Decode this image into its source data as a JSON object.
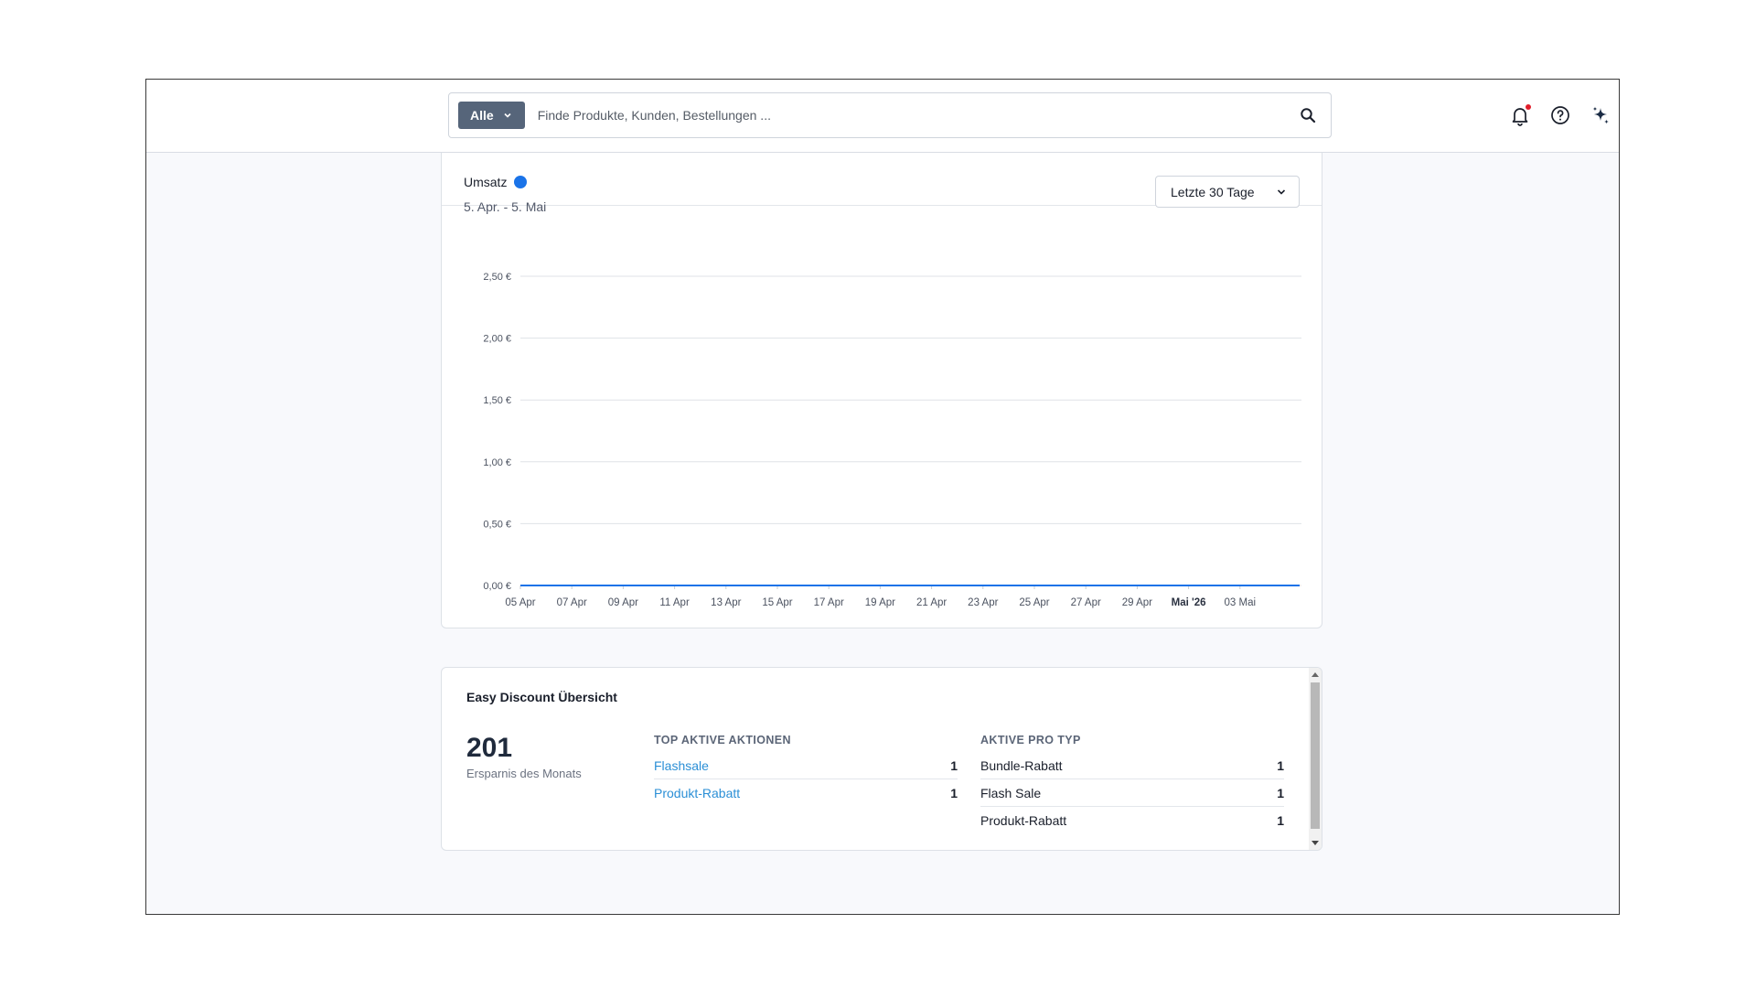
{
  "search": {
    "scope_label": "Alle",
    "placeholder": "Finde Produkte, Kunden, Bestellungen ..."
  },
  "icons": {
    "search": "search-icon",
    "notifications": "bell-icon",
    "help": "help-icon",
    "ai": "sparkles-icon"
  },
  "colors": {
    "accent": "#1a73e8",
    "link": "#2b8fd6",
    "scope_button": "#56657a",
    "notification_dot": "#e11d2a"
  },
  "revenue_card": {
    "title": "Umsatz",
    "date_range": "5. Apr. - 5. Mai",
    "period_selected": "Letzte 30 Tage"
  },
  "chart_data": {
    "type": "line",
    "x_ticks": [
      "05 Apr",
      "07 Apr",
      "09 Apr",
      "11 Apr",
      "13 Apr",
      "15 Apr",
      "17 Apr",
      "19 Apr",
      "21 Apr",
      "23 Apr",
      "25 Apr",
      "27 Apr",
      "29 Apr",
      "Mai '26",
      "03 Mai"
    ],
    "x_tick_bold": "Mai '26",
    "y_ticks": [
      "0,00 €",
      "0,50 €",
      "1,00 €",
      "1,50 €",
      "2,00 €",
      "2,50 €"
    ],
    "ylim": [
      0,
      2.5
    ],
    "grid": true,
    "series": [
      {
        "color": "#1a73e8",
        "values": [
          0,
          0,
          0,
          0,
          0,
          0,
          0,
          0,
          0,
          0,
          0,
          0,
          0,
          0,
          0
        ]
      }
    ]
  },
  "discount_card": {
    "title": "Easy Discount Übersicht",
    "savings_value": "201",
    "savings_label": "Ersparnis des Monats",
    "top_actions": {
      "header": "TOP AKTIVE AKTIONEN",
      "rows": [
        {
          "label": "Flashsale",
          "count": "1"
        },
        {
          "label": "Produkt-Rabatt",
          "count": "1"
        }
      ]
    },
    "by_type": {
      "header": "AKTIVE PRO TYP",
      "rows": [
        {
          "label": "Bundle-Rabatt",
          "count": "1"
        },
        {
          "label": "Flash Sale",
          "count": "1"
        },
        {
          "label": "Produkt-Rabatt",
          "count": "1"
        }
      ]
    }
  }
}
